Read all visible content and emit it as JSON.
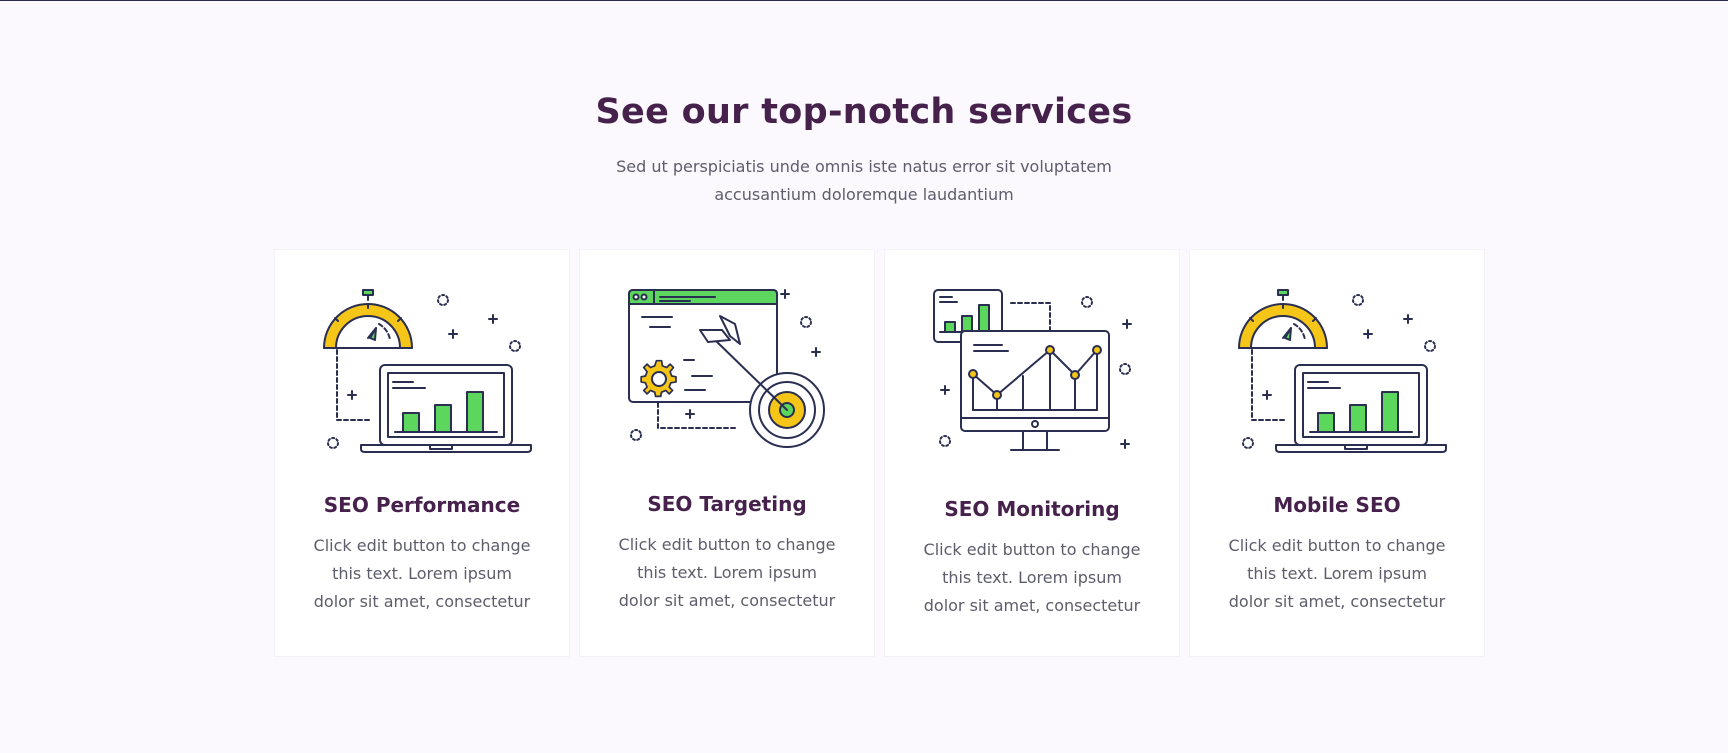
{
  "section": {
    "title": "See our top-notch services",
    "subtitle": "Sed ut perspiciatis unde omnis iste natus error sit voluptatem accusantium doloremque laudantium"
  },
  "colors": {
    "heading": "#46214c",
    "text": "#5d5d6b",
    "accent_green": "#5cd65c",
    "accent_yellow": "#f5c518",
    "outline": "#2a2f52",
    "background": "#fbf8fe"
  },
  "cards": [
    {
      "icon": "stopwatch-laptop-chart-icon",
      "title": "SEO Performance",
      "text": "Click edit button to change this text. Lorem ipsum dolor sit amet, consectetur"
    },
    {
      "icon": "browser-target-arrow-icon",
      "title": "SEO Targeting",
      "text": "Click edit button to change this text. Lorem ipsum dolor sit amet, consectetur"
    },
    {
      "icon": "monitor-line-chart-icon",
      "title": "SEO Monitoring",
      "text": "Click edit button to change this text. Lorem ipsum dolor sit amet, consectetur"
    },
    {
      "icon": "stopwatch-laptop-chart-icon",
      "title": "Mobile SEO",
      "text": "Click edit button to change this text. Lorem ipsum dolor sit amet, consectetur"
    }
  ]
}
